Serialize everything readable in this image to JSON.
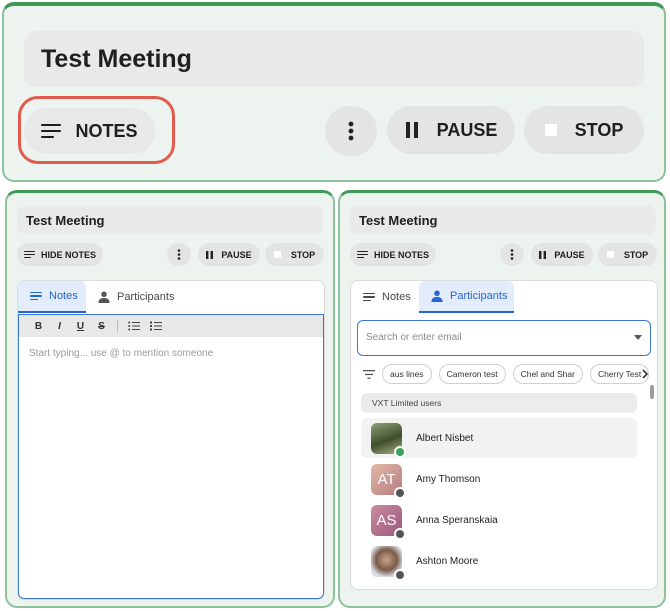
{
  "top_panel": {
    "title": "Test Meeting",
    "notes_label": "NOTES",
    "pause_label": "PAUSE",
    "stop_label": "STOP"
  },
  "left_panel": {
    "title": "Test Meeting",
    "hide_notes_label": "HIDE NOTES",
    "pause_label": "PAUSE",
    "stop_label": "STOP",
    "tabs": [
      {
        "label": "Notes",
        "active": true
      },
      {
        "label": "Participants",
        "active": false
      }
    ],
    "toolbar": [
      "B",
      "I",
      "U",
      "S"
    ],
    "editor_placeholder": "Start typing... use @ to mention someone"
  },
  "right_panel": {
    "title": "Test Meeting",
    "hide_notes_label": "HIDE NOTES",
    "pause_label": "PAUSE",
    "stop_label": "STOP",
    "tabs": [
      {
        "label": "Notes",
        "active": false
      },
      {
        "label": "Participants",
        "active": true
      }
    ],
    "search_placeholder": "Search or enter email",
    "chips": [
      "aus lines",
      "Cameron test",
      "Chel and Shar",
      "Cherry Test"
    ],
    "group_label": "VXT Limited users",
    "users": [
      {
        "name": "Albert Nisbet",
        "initials": "",
        "status": "online"
      },
      {
        "name": "Amy Thomson",
        "initials": "AT",
        "status": "offline"
      },
      {
        "name": "Anna Speranskaia",
        "initials": "AS",
        "status": "offline"
      },
      {
        "name": "Ashton Moore",
        "initials": "",
        "status": "offline"
      }
    ]
  },
  "colors": {
    "accent": "#2466d4",
    "stop": "#e53935",
    "panel_border": "#3f9a5a",
    "notes_highlight": "#e25b4c"
  },
  "icons": [
    "menu-lines-icon",
    "more-vert-icon",
    "pause-icon",
    "stop-icon",
    "person-icon",
    "filter-icon",
    "chevron-right-icon",
    "caret-down-icon"
  ]
}
